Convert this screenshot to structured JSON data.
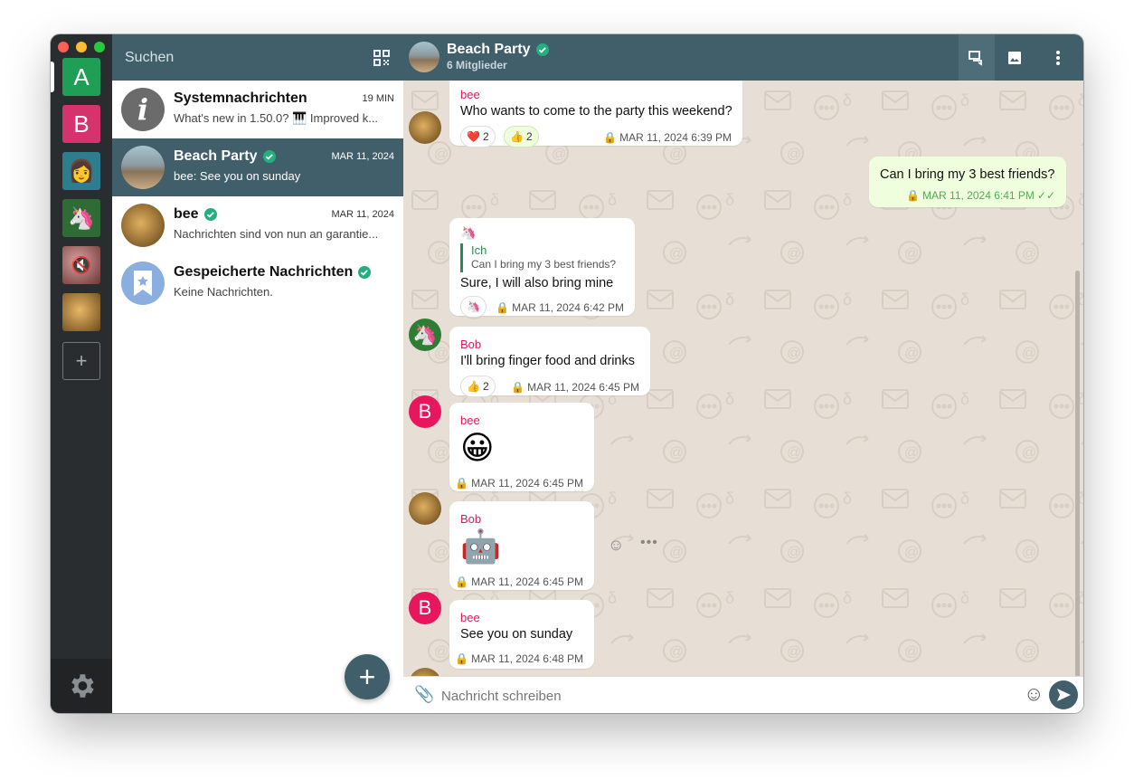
{
  "accounts": [
    {
      "label": "A",
      "color": "#1f9f55"
    },
    {
      "label": "B",
      "color": "#d81b60"
    },
    {
      "label": "woman-avatar",
      "color": "#2d7d8e"
    },
    {
      "label": "unicorn-avatar",
      "color": "#2e7d32"
    },
    {
      "label": "muted-photo",
      "color": "#8a4a4a"
    },
    {
      "label": "bee-photo",
      "color": "#b07a2a"
    }
  ],
  "chatlist": {
    "search_placeholder": "Suchen",
    "chats": [
      {
        "title": "Systemnachrichten",
        "date": "19 MIN",
        "subtitle": "What's new in 1.50.0? 🎹 Improved k..."
      },
      {
        "title": "Beach Party",
        "date": "MAR 11, 2024",
        "subtitle": "bee: See you on sunday",
        "verified": true
      },
      {
        "title": "bee",
        "date": "MAR 11, 2024",
        "subtitle": "Nachrichten sind von nun an garantie...",
        "verified": true
      },
      {
        "title": "Gespeicherte Nachrichten",
        "date": "",
        "subtitle": "Keine Nachrichten.",
        "verified": true
      }
    ]
  },
  "header": {
    "title": "Beach Party",
    "subtitle": "6 Mitglieder"
  },
  "messages": [
    {
      "sender": "bee",
      "text": "Who wants to come to the party this weekend?",
      "time": "MAR 11, 2024 6:39 PM",
      "reactions": [
        {
          "emoji": "❤️",
          "count": "2"
        },
        {
          "emoji": "👍",
          "count": "2"
        }
      ]
    },
    {
      "text": "Can I bring my 3 best friends?",
      "time": "MAR 11, 2024 6:41 PM"
    },
    {
      "sender_emoji": "🦄",
      "quote_author": "Ich",
      "quote_text": "Can I bring my 3 best friends?",
      "text": "Sure, I will also bring mine",
      "time": "MAR 11, 2024 6:42 PM",
      "reactions": [
        {
          "emoji": "🦄"
        }
      ]
    },
    {
      "sender": "Bob",
      "text": "I'll bring finger food and drinks",
      "time": "MAR 11, 2024 6:45 PM",
      "reactions": [
        {
          "emoji": "👍",
          "count": "2"
        }
      ]
    },
    {
      "sender": "bee",
      "emoji": "😀",
      "time": "MAR 11, 2024 6:45 PM"
    },
    {
      "sender": "Bob",
      "emoji": "🤖",
      "time": "MAR 11, 2024 6:45 PM"
    },
    {
      "sender": "bee",
      "text": "See you on sunday",
      "time": "MAR 11, 2024 6:48 PM"
    }
  ],
  "composer": {
    "placeholder": "Nachricht schreiben"
  },
  "colors": {
    "header": "#415e6b",
    "sender_bob": "#d81b60",
    "sender_bee": "#d81b60",
    "quote": "#2e8b57",
    "verified": "#23b07d"
  }
}
